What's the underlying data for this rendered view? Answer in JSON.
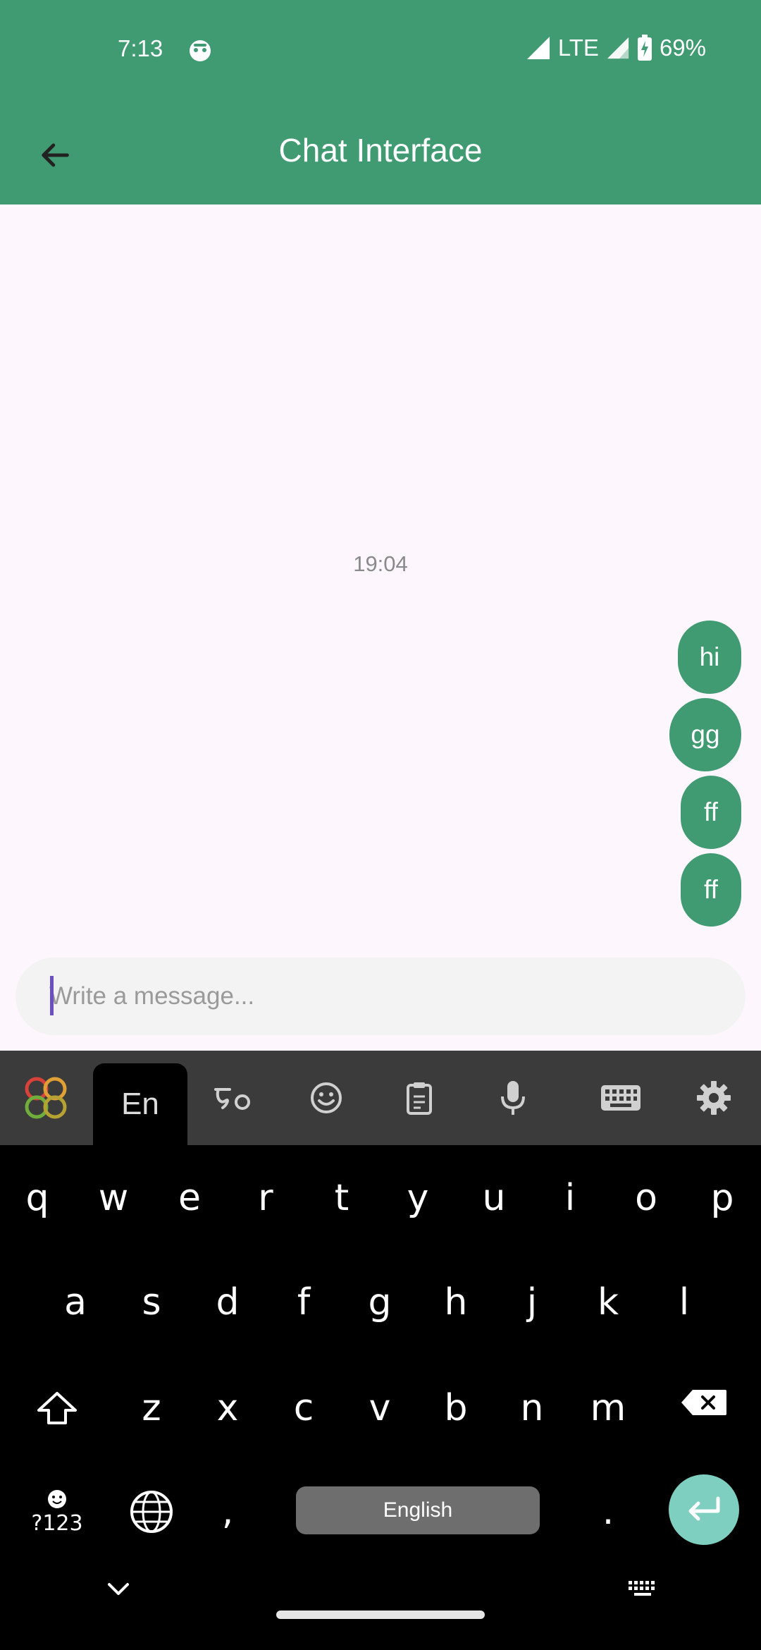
{
  "status_bar": {
    "time": "7:13",
    "network": "LTE",
    "battery": "69%",
    "icons": [
      "app-notification-icon",
      "signal-icon",
      "signal-icon",
      "battery-charging-icon"
    ]
  },
  "app_bar": {
    "title": "Chat Interface",
    "back_icon": "arrow-left-icon",
    "color": "#409a72"
  },
  "chat": {
    "timestamp": "19:04",
    "messages": [
      {
        "text": "hi",
        "sender": "me"
      },
      {
        "text": "gg",
        "sender": "me"
      },
      {
        "text": "ff",
        "sender": "me"
      },
      {
        "text": "ff",
        "sender": "me"
      }
    ],
    "bubble_color": "#409a72"
  },
  "composer": {
    "placeholder": "Write a message...",
    "value": ""
  },
  "keyboard": {
    "toolbar": {
      "language_tab": "En",
      "items": [
        "logo-icon",
        "transliterate-icon",
        "emoji-icon",
        "clipboard-icon",
        "microphone-icon",
        "keyboard-icon",
        "settings-icon"
      ]
    },
    "rows": [
      [
        "q",
        "w",
        "e",
        "r",
        "t",
        "y",
        "u",
        "i",
        "o",
        "p"
      ],
      [
        "a",
        "s",
        "d",
        "f",
        "g",
        "h",
        "j",
        "k",
        "l"
      ],
      [
        "z",
        "x",
        "c",
        "v",
        "b",
        "n",
        "m"
      ]
    ],
    "symbols_key": "?123",
    "comma": ",",
    "period": ".",
    "space_label": "English",
    "enter_color": "#7ecfbf"
  }
}
